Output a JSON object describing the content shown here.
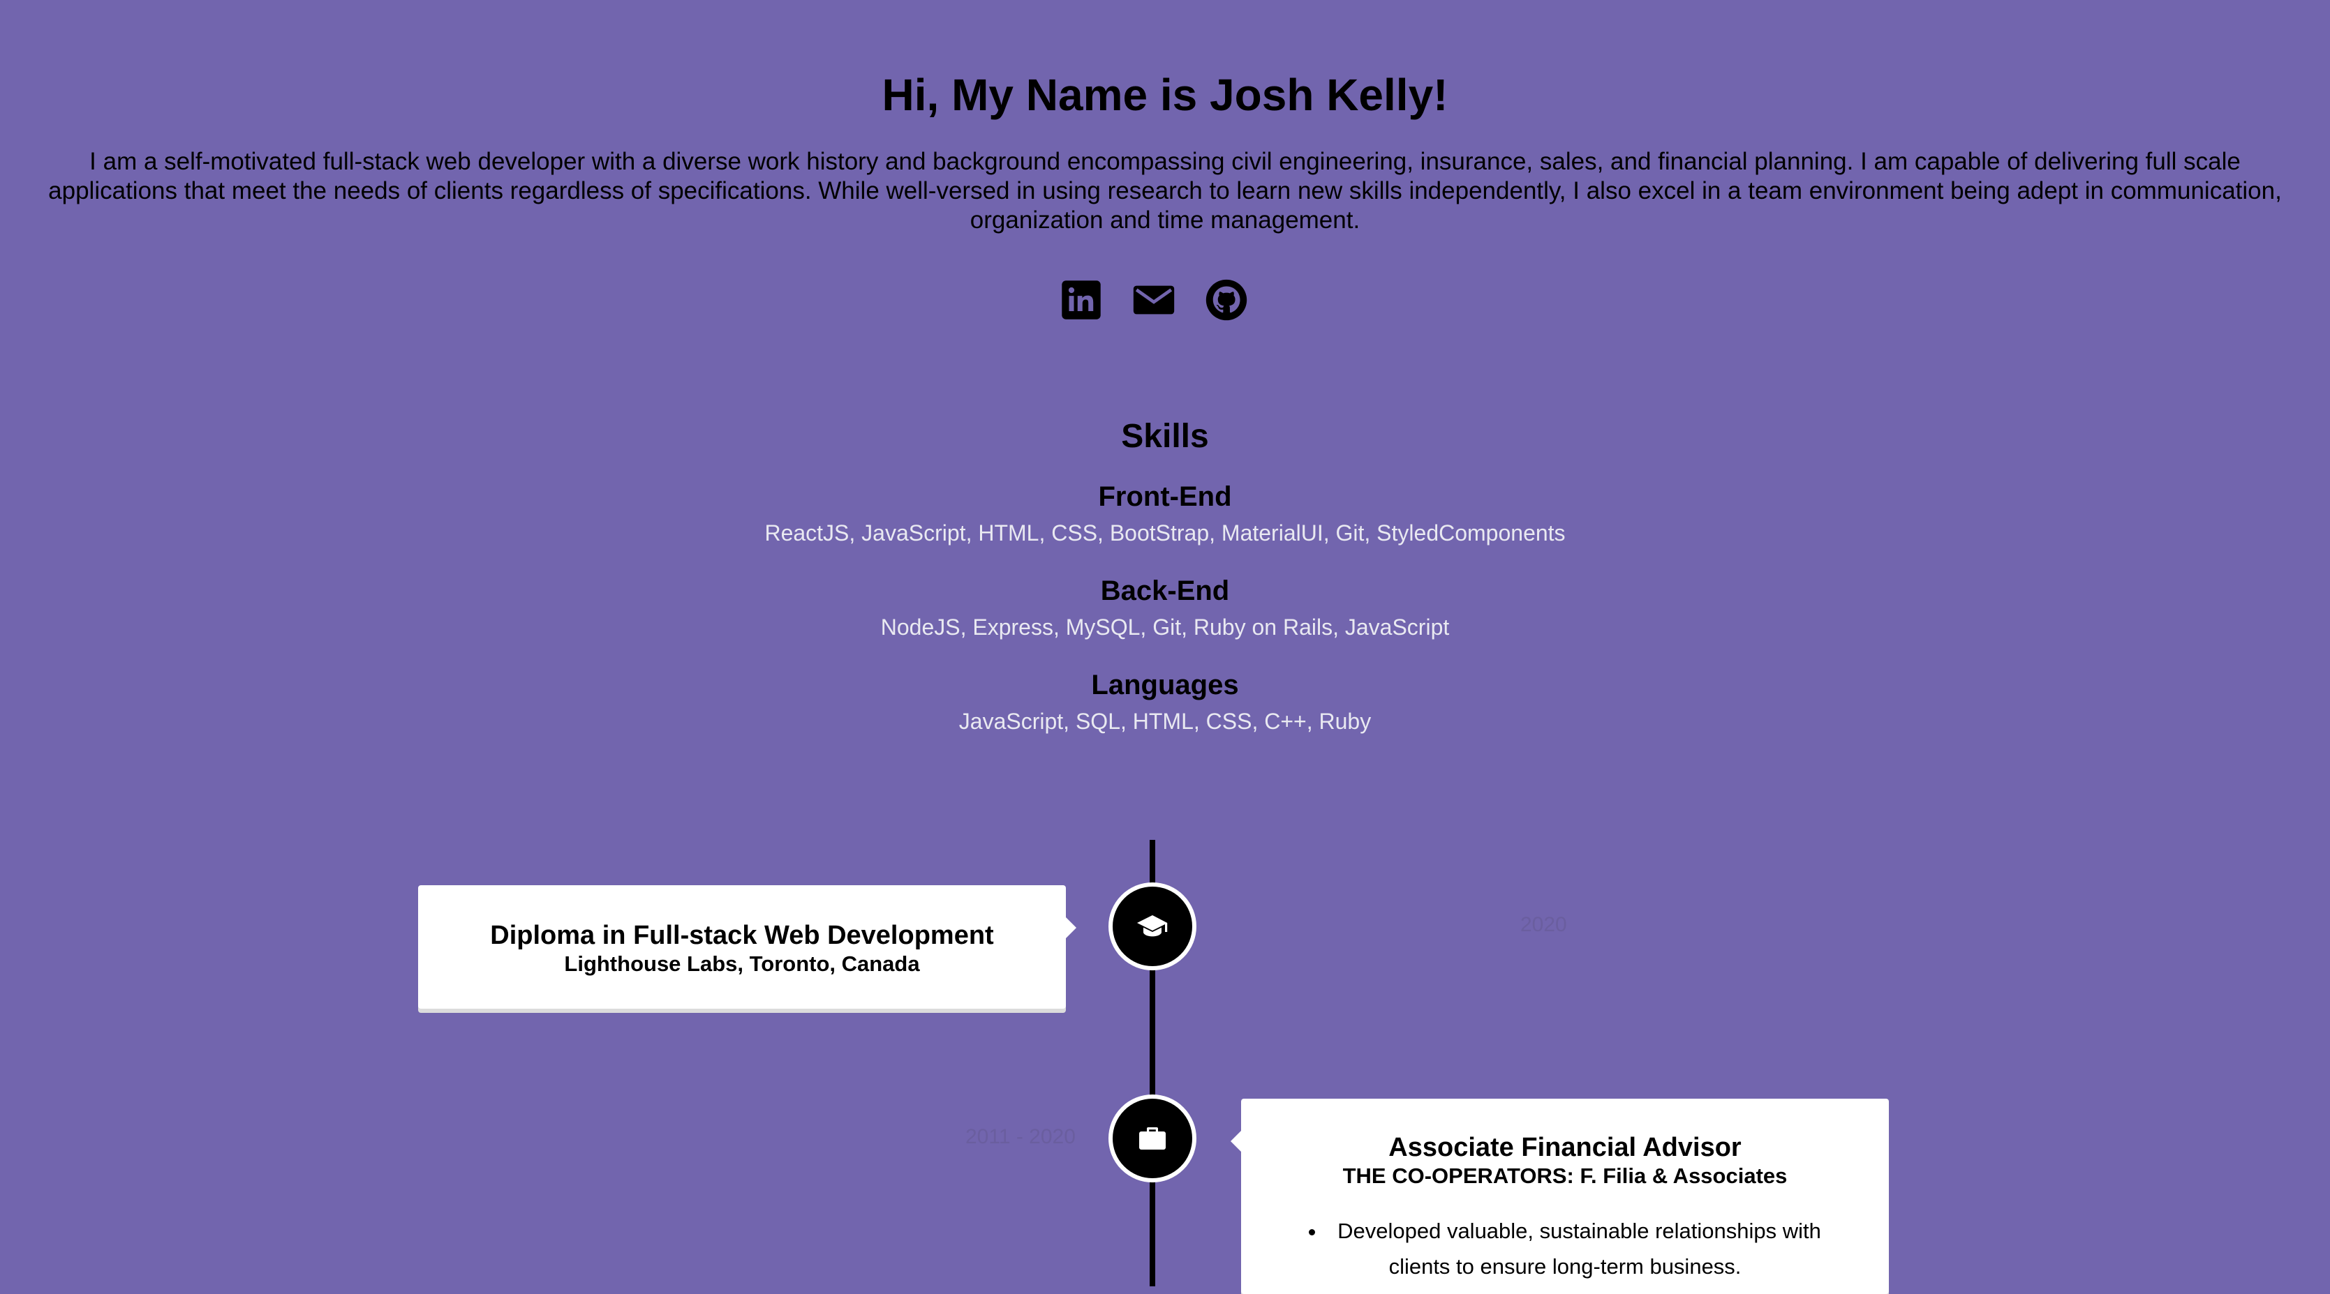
{
  "header": {
    "title": "Hi, My Name is Josh Kelly!",
    "bio": "I am a self-motivated full-stack web developer with a diverse work history and background encompassing civil engineering, insurance, sales, and financial planning. I am capable of delivering full scale applications that meet the needs of clients regardless of specifications. While well-versed in using research to learn new skills independently, I also excel in a team environment being adept in communication, organization and time management."
  },
  "socials": [
    {
      "icon": "linkedin-icon"
    },
    {
      "icon": "email-icon"
    },
    {
      "icon": "github-icon"
    }
  ],
  "skills": {
    "heading": "Skills",
    "groups": [
      {
        "title": "Front-End",
        "items": "ReactJS, JavaScript, HTML, CSS, BootStrap, MaterialUI, Git, StyledComponents"
      },
      {
        "title": "Back-End",
        "items": "NodeJS, Express, MySQL, Git, Ruby on Rails, JavaScript"
      },
      {
        "title": "Languages",
        "items": "JavaScript, SQL, HTML, CSS, C++, Ruby"
      }
    ]
  },
  "timeline": [
    {
      "icon": "graduation-cap-icon",
      "date": "2020",
      "title": "Diploma in Full-stack Web Development",
      "subtitle": "Lighthouse Labs, Toronto, Canada"
    },
    {
      "icon": "briefcase-icon",
      "date": "2011 - 2020",
      "title": "Associate Financial Advisor",
      "subtitle": "THE CO-OPERATORS: F. Filia & Associates",
      "bullets": [
        "Developed valuable, sustainable relationships with clients to ensure long-term business."
      ]
    }
  ],
  "colors": {
    "background": "#7265ae",
    "card": "#ffffff",
    "skill_text": "#e9e9f1",
    "date_text": "#6a5e9f"
  }
}
